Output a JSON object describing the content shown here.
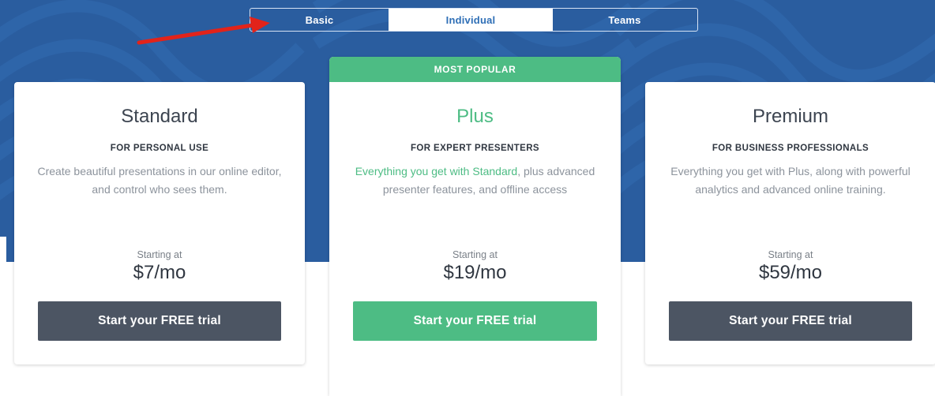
{
  "tabs": [
    {
      "label": "Basic"
    },
    {
      "label": "Individual"
    },
    {
      "label": "Teams"
    }
  ],
  "selected_tab": "Individual",
  "colors": {
    "hero_blue": "#2a5d9f",
    "accent_green": "#4dbc84",
    "button_dark": "#4c5563",
    "arrow_red": "#e2231a"
  },
  "plans": [
    {
      "title": "Standard",
      "subtitle": "FOR PERSONAL USE",
      "description": "Create beautiful presentations in our online editor, and control who sees them.",
      "starting_label": "Starting at",
      "price": "$7/mo",
      "cta": "Start your FREE trial"
    },
    {
      "banner": "MOST POPULAR",
      "title": "Plus",
      "subtitle": "FOR EXPERT PRESENTERS",
      "description_highlight": "Everything you get with Standard",
      "description_rest": ", plus advanced presenter features, and offline access",
      "starting_label": "Starting at",
      "price": "$19/mo",
      "cta": "Start your FREE trial"
    },
    {
      "title": "Premium",
      "subtitle": "FOR BUSINESS PROFESSIONALS",
      "description": "Everything you get with Plus, along with powerful analytics and advanced online training.",
      "starting_label": "Starting at",
      "price": "$59/mo",
      "cta": "Start your FREE trial"
    }
  ]
}
